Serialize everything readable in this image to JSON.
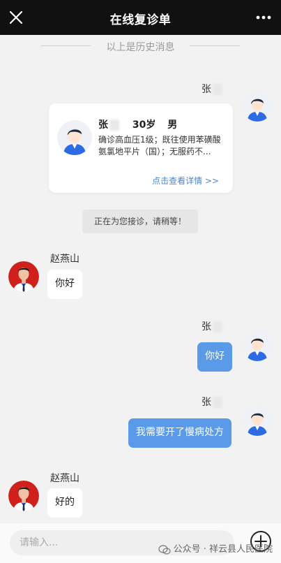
{
  "header": {
    "title": "在线复诊单",
    "close_icon": "close-icon",
    "more_icon": "more-icon"
  },
  "history_divider": "以上是历史消息",
  "patient": {
    "name": "张",
    "age": "30岁",
    "sex": "男",
    "summary": "确诊高血压1级；既往使用苯磺酸氨氯地平片（国）；无服药不...",
    "detail_link": "点击查看详情 >>"
  },
  "status_text": "正在为您接诊，请稍等！",
  "doctor": {
    "name": "赵燕山"
  },
  "messages": [
    {
      "sender": "doctor",
      "text": "你好"
    },
    {
      "sender": "patient",
      "name": "张",
      "text": "你好"
    },
    {
      "sender": "patient",
      "name": "张",
      "text": "我需要开了慢病处方"
    },
    {
      "sender": "doctor",
      "text": "好的"
    }
  ],
  "input": {
    "placeholder": "请输入..."
  },
  "watermark": "公众号 · 祥云县人民医院",
  "colors": {
    "header_bg": "#111111",
    "bubble_blue": "#5b9ae8",
    "link_blue": "#4a86c7",
    "doctor_avatar_bg": "#d0201c",
    "patient_shirt": "#2d6be4"
  }
}
